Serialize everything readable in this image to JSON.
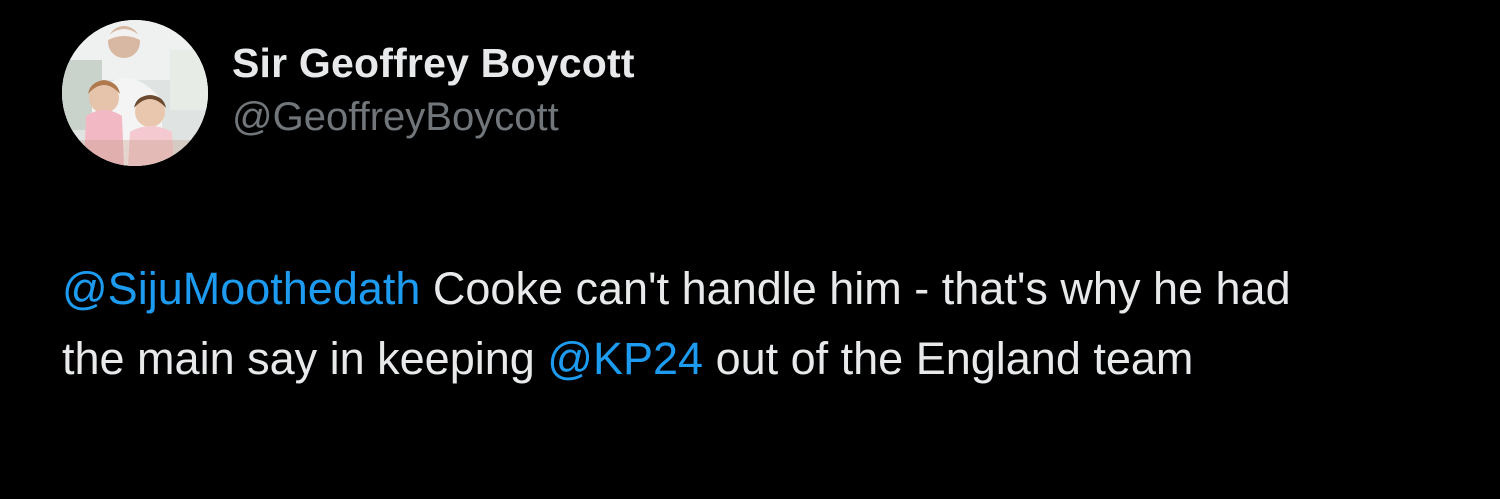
{
  "colors": {
    "background": "#000000",
    "primary_text": "#e7e9ea",
    "secondary_text": "#71767b",
    "mention": "#1d9bf0"
  },
  "author": {
    "avatar_icon": "profile-photo",
    "display_name": "Sir Geoffrey Boycott",
    "handle": "@GeoffreyBoycott"
  },
  "tweet": {
    "mention_1": "@SijuMoothedath",
    "text_1": " Cooke can't handle him - that's why he had the main say in keeping ",
    "mention_2": "@KP24",
    "text_2": " out of the England team"
  }
}
